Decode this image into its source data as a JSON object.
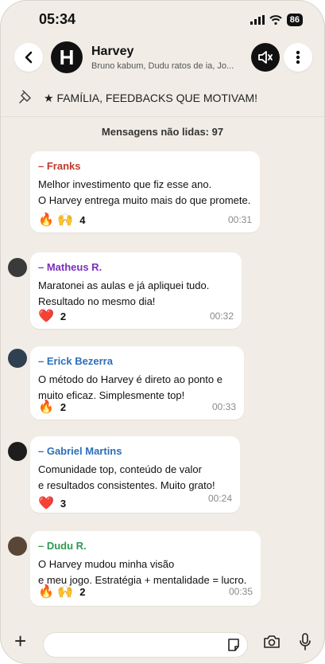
{
  "status_bar": {
    "time": "05:34",
    "battery": "86"
  },
  "header": {
    "avatar_letter": "H",
    "title": "Harvey",
    "subtitle": "Bruno kabum, Dudu ratos de ia, Jo..."
  },
  "pinned": {
    "text": "★ FAMÍLIA, FEEDBACKS QUE MOTIVAM!"
  },
  "unread_label": "Mensagens não lidas: 97",
  "messages": [
    {
      "sender": "– Franks",
      "color": "#c0392b",
      "lines": [
        "Melhor investimento que fiz esse ano.",
        "O Harvey entrega muito mais do que promete."
      ],
      "reactions": "🔥 🙌",
      "count": "4",
      "time": "00:31"
    },
    {
      "sender": "– Matheus R.",
      "color": "#7b2fbe",
      "lines": [
        "Maratonei as aulas e já apliquei tudo.",
        "Resultado no mesmo dia!"
      ],
      "reactions": "❤️",
      "count": "2",
      "time": "00:32"
    },
    {
      "sender": "– Erick Bezerra",
      "color": "#2c6fbb",
      "lines": [
        "O método do Harvey é direto ao ponto e",
        "muito eficaz. Simplesmente top!"
      ],
      "reactions": "🔥",
      "count": "2",
      "time": "00:33"
    },
    {
      "sender": "– Gabriel Martins",
      "color": "#2c6fbb",
      "lines": [
        "Comunidade top, conteúdo de valor",
        "e resultados consistentes. Muito grato!"
      ],
      "reactions": "❤️",
      "count": "3",
      "time": "00:24"
    },
    {
      "sender": "– Dudu R.",
      "color": "#2e9b4f",
      "lines": [
        "O Harvey mudou minha visão",
        "e meu jogo. Estratégia + mentalidade = lucro."
      ],
      "reactions": "🔥 🙌",
      "count": "2",
      "time": "00:35"
    }
  ]
}
